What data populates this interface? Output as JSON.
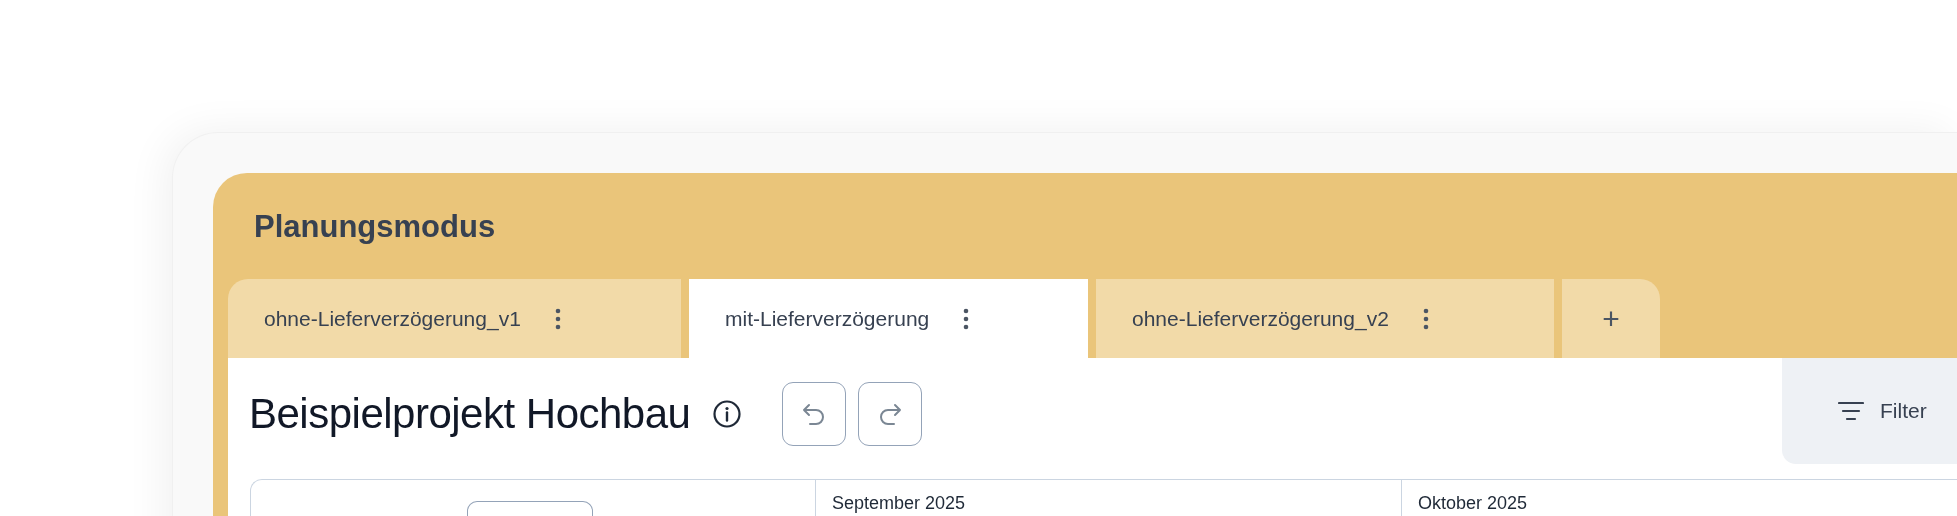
{
  "panel": {
    "title": "Planungsmodus"
  },
  "tabs": [
    {
      "label": "ohne-Lieferverzögerung_v1",
      "selected": false
    },
    {
      "label": "mit-Lieferverzögerung",
      "selected": true
    },
    {
      "label": "ohne-Lieferverzögerung_v2",
      "selected": false
    }
  ],
  "add_tab": {
    "label": "+"
  },
  "project": {
    "title": "Beispielprojekt Hochbau"
  },
  "filter": {
    "label": "Filter"
  },
  "timeline": {
    "months": [
      "September 2025",
      "Oktober 2025"
    ]
  }
}
